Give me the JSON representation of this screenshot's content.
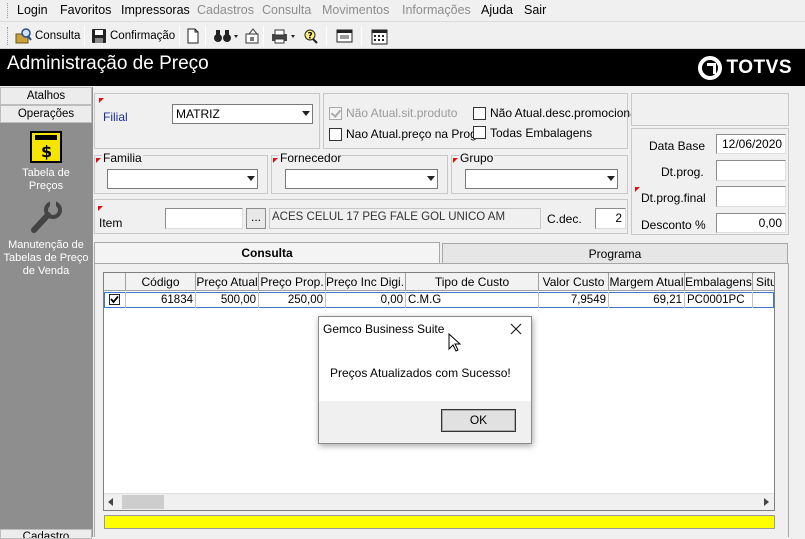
{
  "menu": {
    "items": [
      {
        "label": "Login",
        "enabled": true
      },
      {
        "label": "Favoritos",
        "enabled": true
      },
      {
        "label": "Impressoras",
        "enabled": true
      },
      {
        "label": "Cadastros",
        "enabled": false
      },
      {
        "label": "Consulta",
        "enabled": false
      },
      {
        "label": "Movimentos",
        "enabled": false
      },
      {
        "label": "Informações",
        "enabled": false
      },
      {
        "label": "Ajuda",
        "enabled": true
      },
      {
        "label": "Sair",
        "enabled": true
      }
    ]
  },
  "toolbar": {
    "consulta_label": "Consulta",
    "confirmacao_label": "Confirmação"
  },
  "window": {
    "title": "Administração de Preço",
    "brand": "TOTVS"
  },
  "sidebar": {
    "tabs": [
      "Atalhos",
      "Operações"
    ],
    "items": [
      {
        "label": "Tabela de Preços",
        "icon": "price-table-icon"
      },
      {
        "label": "Manutenção de Tabelas de Preço de Venda",
        "icon": "wrench-icon"
      }
    ],
    "bottom_tab": "Cadastro"
  },
  "filters": {
    "filial_label": "Filial",
    "filial_value": "MATRIZ",
    "chk_nao_atual_sit_produto": "Não Atual.sit.produto",
    "chk_nao_atual_preco_progr": "Nao Atual.preço na Progr.",
    "chk_nao_atual_desc_promocional": "Não Atual.desc.promocional",
    "chk_todas_embalagens": "Todas Embalagens",
    "familia_label": "Familia",
    "fornecedor_label": "Fornecedor",
    "grupo_label": "Grupo",
    "item_label": "Item",
    "item_button": "...",
    "item_description": "ACES CELUL 17 PEG FALE GOL UNICO  AM",
    "cdec_label": "C.dec.",
    "cdec_value": "2",
    "data_base_label": "Data Base",
    "data_base_value": "12/06/2020",
    "dt_prog_label": "Dt.prog.",
    "dt_prog_final_label": "Dt.prog.final",
    "desconto_label": "Desconto %",
    "desconto_value": "0,00"
  },
  "tabs": [
    "Consulta",
    "Programa"
  ],
  "grid": {
    "columns": [
      "Código",
      "Preço Atual",
      "Preço Prop.",
      "Preço Inc Digi...",
      "Tipo de Custo",
      "Valor Custo",
      "Margem Atual",
      "Embalagens",
      "Situ"
    ],
    "rows": [
      {
        "checked": true,
        "codigo": "61834",
        "preco_atual": "500,00",
        "preco_prop": "250,00",
        "preco_inc_digi": "0,00",
        "tipo_custo": "C.M.G",
        "valor_custo": "7,9549",
        "margem_atual": "69,21",
        "embalagens": "PC0001PC",
        "situ": ""
      }
    ]
  },
  "status_bar_color": "#ffff00",
  "dialog": {
    "title": "Gemco Business Suite",
    "message": "Preços Atualizados com Sucesso!",
    "ok_label": "OK"
  }
}
